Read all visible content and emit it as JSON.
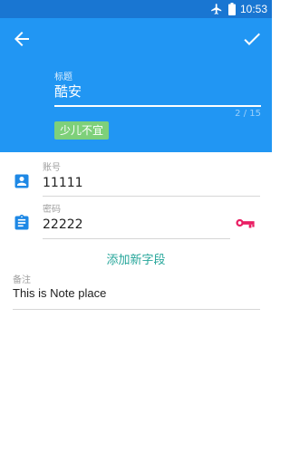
{
  "status_bar": {
    "time": "10:53",
    "icons": [
      "airplane-icon",
      "battery-icon"
    ]
  },
  "toolbar": {
    "back_icon": "arrow-left-icon",
    "confirm_icon": "check-icon"
  },
  "title_field": {
    "label": "标题",
    "value": "酷安",
    "counter": "2 / 15"
  },
  "tag": {
    "label": "少儿不宜",
    "color": "#7ED07A"
  },
  "fields": [
    {
      "label": "账号",
      "value": "11111",
      "icon": "account-badge-icon"
    },
    {
      "label": "密码",
      "value": "22222",
      "icon": "clipboard-icon",
      "action_icon": "key-icon"
    }
  ],
  "add_field_label": "添加新字段",
  "note": {
    "label": "备注",
    "value": "This is Note place"
  },
  "colors": {
    "status_bar": "#1976D2",
    "header": "#2196F3",
    "accent_teal": "#26A69A",
    "field_icon_blue": "#1E88E5",
    "key_icon_pink": "#E91E63"
  }
}
